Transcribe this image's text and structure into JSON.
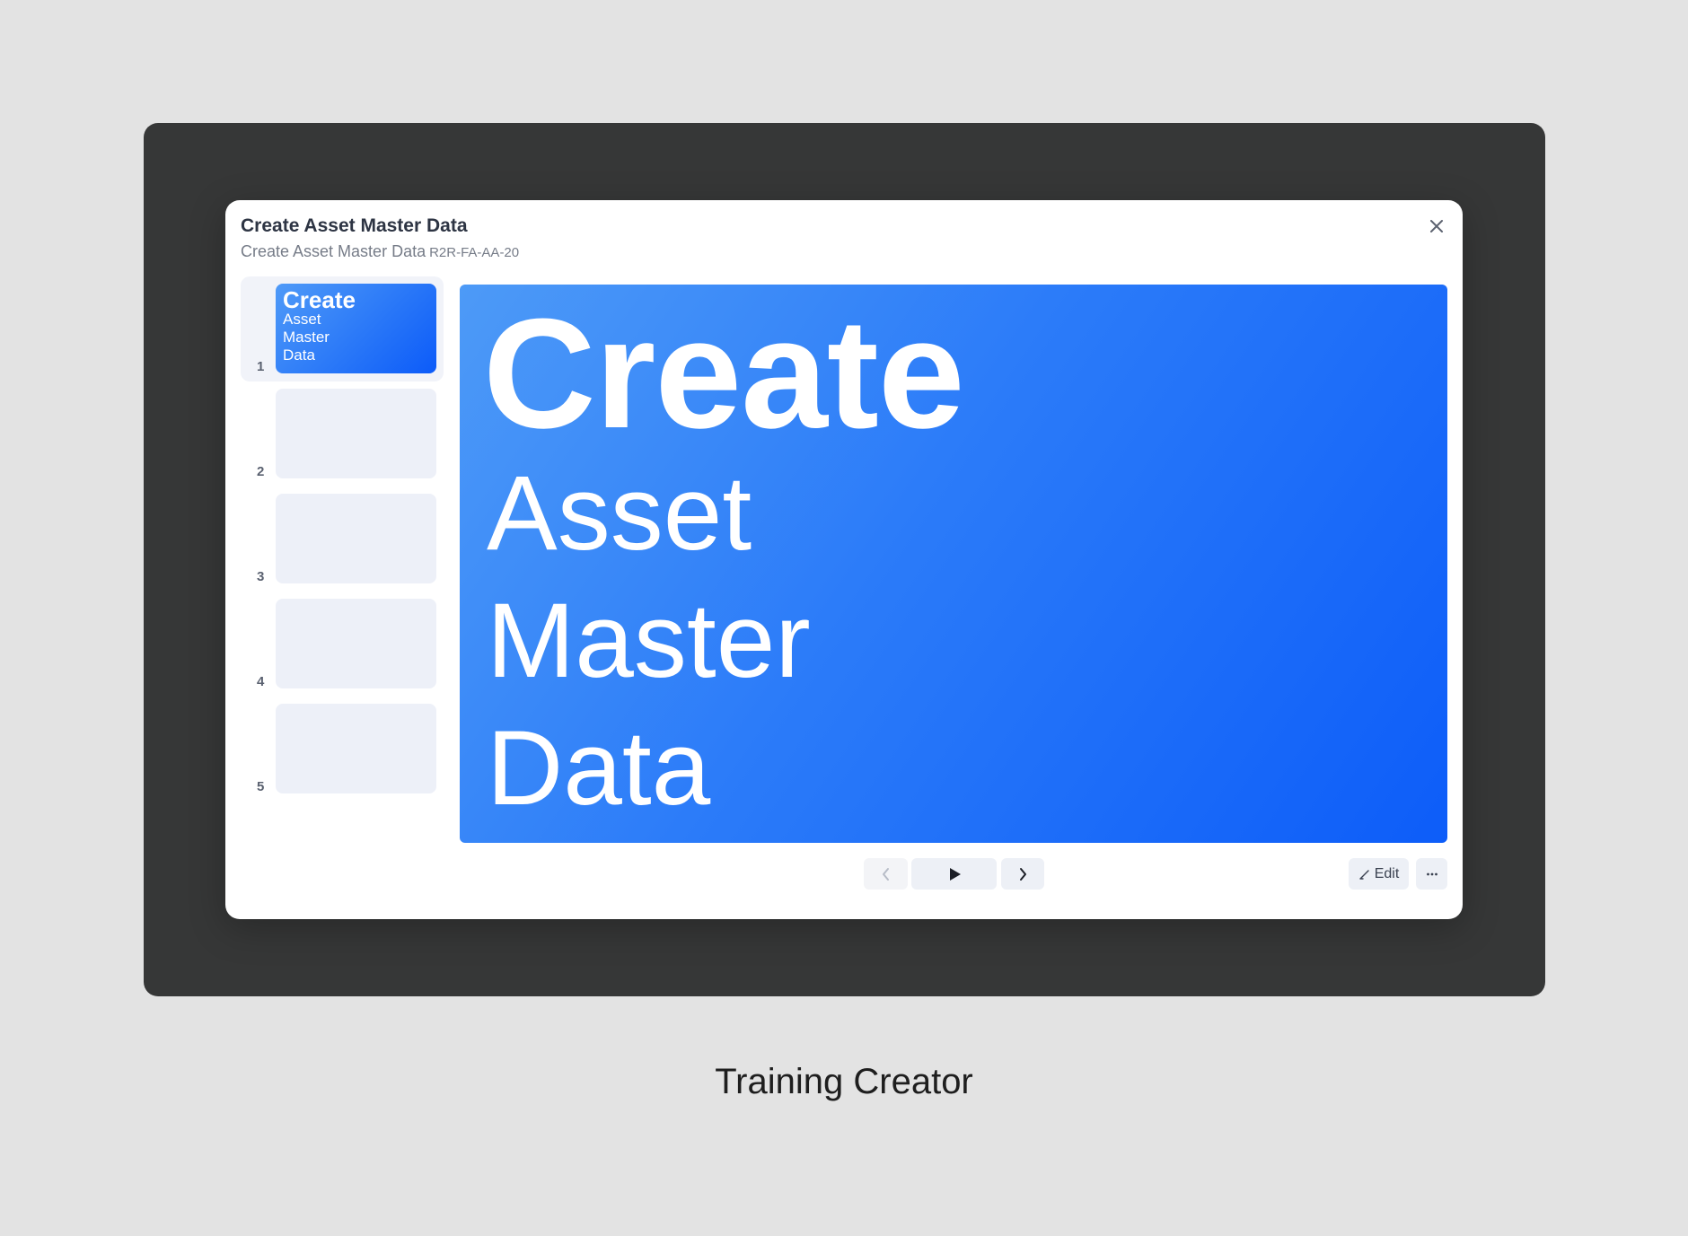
{
  "dialog": {
    "title": "Create Asset Master Data",
    "subtitle": "Create Asset Master Data",
    "code": "R2R-FA-AA-20"
  },
  "slides": [
    {
      "number": "1",
      "title": "Create",
      "lines": [
        "Asset",
        "Master",
        "Data"
      ]
    },
    {
      "number": "2"
    },
    {
      "number": "3"
    },
    {
      "number": "4"
    },
    {
      "number": "5"
    }
  ],
  "main_slide": {
    "title": "Create",
    "lines": [
      "Asset",
      "Master",
      "Data"
    ]
  },
  "controls": {
    "prev_icon": "chevron-left-icon",
    "play_icon": "play-icon",
    "next_icon": "chevron-right-icon",
    "edit_label": "Edit",
    "more_icon": "more-horizontal-icon"
  },
  "caption": "Training Creator",
  "colors": {
    "accent_start": "#4f9af8",
    "accent_end": "#0c5bf9",
    "stage_bg": "#363737",
    "page_bg": "#e3e3e3"
  }
}
